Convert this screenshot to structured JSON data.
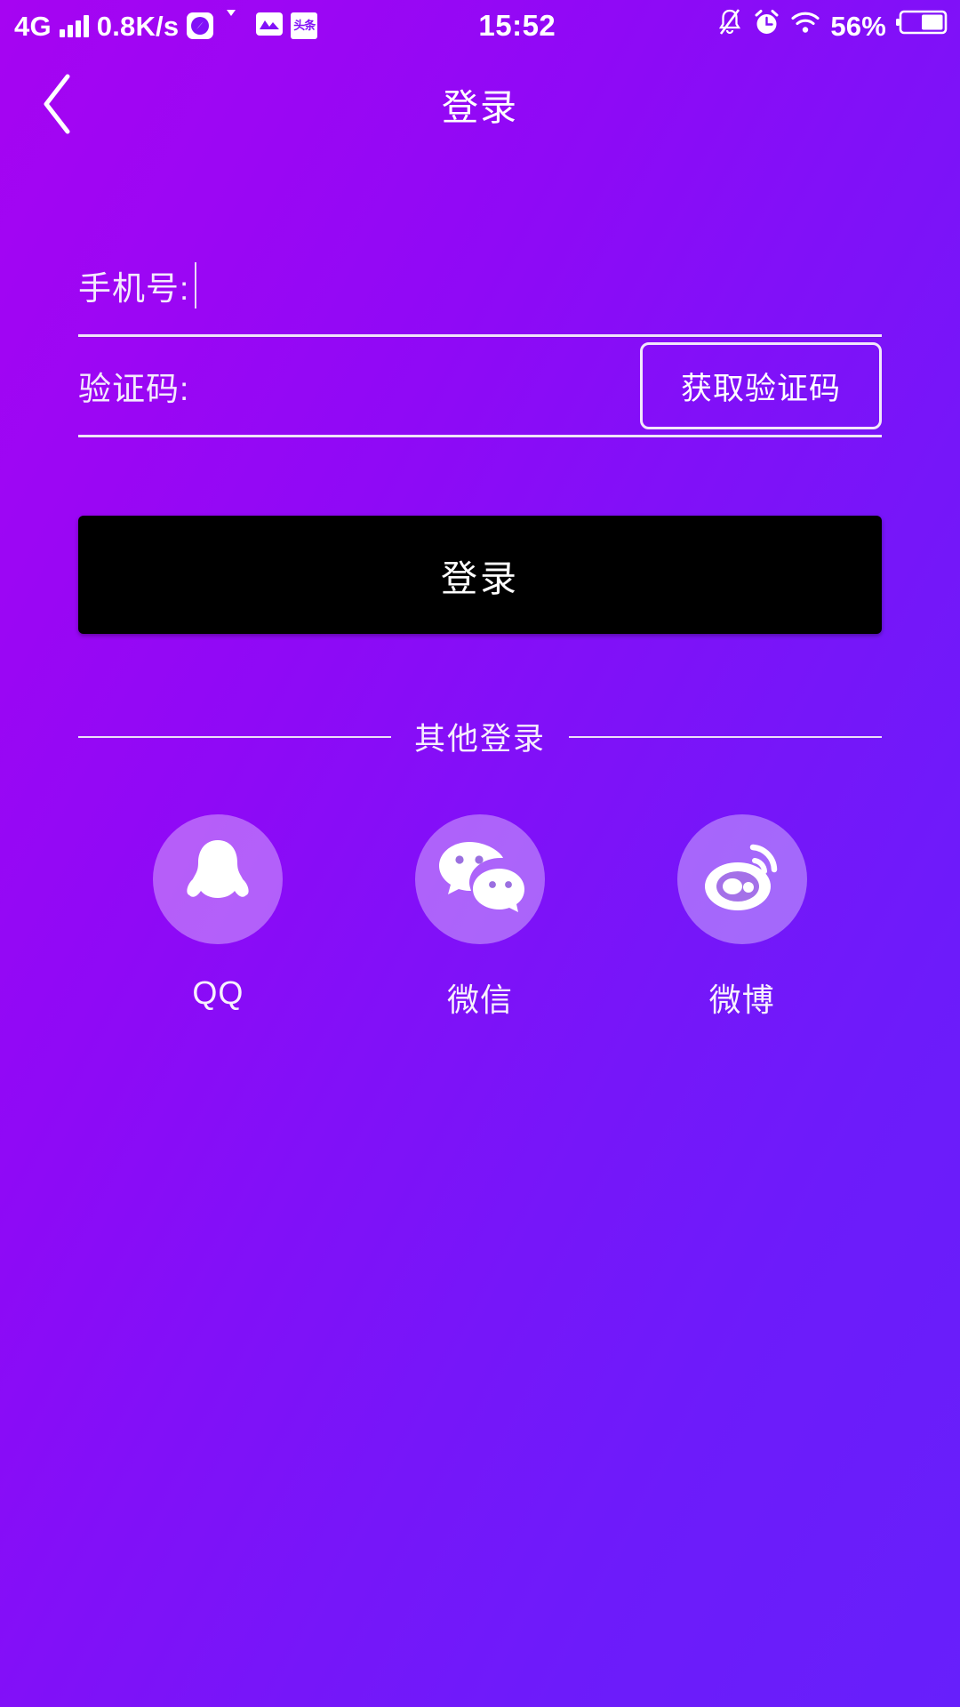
{
  "statusbar": {
    "network_type": "4G",
    "signal_icon": "signal-bars-icon",
    "data_rate": "0.8K/s",
    "app_icons": [
      {
        "name": "compass-app-icon",
        "glyph": "◔"
      },
      {
        "name": "chat-bubble-app-icon",
        "glyph": ""
      },
      {
        "name": "photo-app-icon",
        "glyph": "⌁"
      },
      {
        "name": "toutiao-app-icon",
        "glyph": "头条"
      }
    ],
    "time": "15:52",
    "mute_icon": "bell-muted-icon",
    "alarm_icon": "alarm-clock-icon",
    "wifi_icon": "wifi-icon",
    "battery_percent": "56%",
    "battery_icon": "battery-icon"
  },
  "header": {
    "back_icon": "back-chevron-icon",
    "title": "登录"
  },
  "form": {
    "phone": {
      "label": "手机号:",
      "value": "",
      "placeholder": ""
    },
    "code": {
      "label": "验证码:",
      "value": "",
      "placeholder": "",
      "button_label": "获取验证码"
    },
    "submit_label": "登录"
  },
  "other_login": {
    "divider_label": "其他登录",
    "items": [
      {
        "label": "QQ",
        "icon": "qq-penguin-icon"
      },
      {
        "label": "微信",
        "icon": "wechat-icon"
      },
      {
        "label": "微博",
        "icon": "weibo-icon"
      }
    ]
  },
  "colors": {
    "bg_start": "#a604f2",
    "bg_end": "#671ffb",
    "submit_bg": "#000000",
    "text": "#ffffff",
    "social_circle": "rgba(255,255,255,0.35)"
  }
}
